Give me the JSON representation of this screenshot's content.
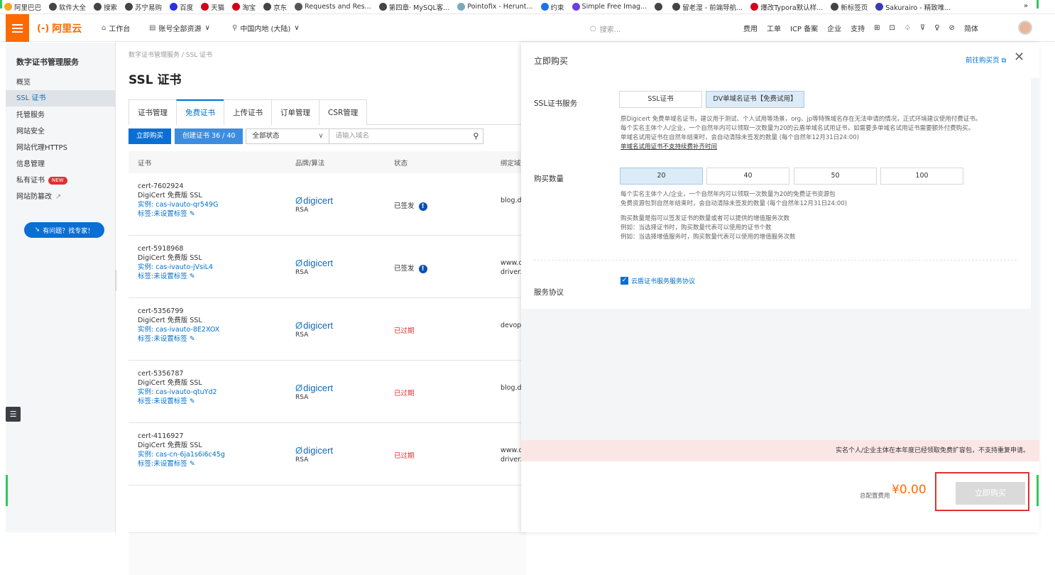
{
  "bookmarks": [
    {
      "label": "阿里巴巴",
      "color": "#f5a623"
    },
    {
      "label": "软件大全",
      "color": "#444"
    },
    {
      "label": "搜索",
      "color": "#444"
    },
    {
      "label": "苏宁易购",
      "color": "#444"
    },
    {
      "label": "百度",
      "color": "#2932e1"
    },
    {
      "label": "天猫",
      "color": "#d0021b"
    },
    {
      "label": "淘宝",
      "color": "#d0021b"
    },
    {
      "label": "京东",
      "color": "#444"
    },
    {
      "label": "Requests and Res...",
      "color": "#555"
    },
    {
      "label": "第四章· MySQL客...",
      "color": "#444"
    },
    {
      "label": "Pointofix - Herunt...",
      "color": "#7ab"
    },
    {
      "label": "约束",
      "color": "#1a73e8"
    },
    {
      "label": "Simple Free Imag...",
      "color": "#6a3de8"
    },
    {
      "label": "",
      "color": "#444"
    },
    {
      "label": "留老湿 - 前端导航...",
      "color": "#444"
    },
    {
      "label": "爆改Typora默认样...",
      "color": "#d0021b"
    },
    {
      "label": "新标签页",
      "color": "#444"
    },
    {
      "label": "Sakurairo - 精致唯...",
      "color": "#3a3ab0"
    }
  ],
  "bookmarks_more": "»",
  "topbar": {
    "logo": "阿里云",
    "workbench": "工作台",
    "account": "账号全部资源",
    "region": "中国内地 (大陆)",
    "search_placeholder": "搜索...",
    "links": [
      "费用",
      "工单",
      "ICP 备案",
      "企业",
      "支持"
    ],
    "lang": "简体"
  },
  "sidebar": {
    "title": "数字证书管理服务",
    "items": [
      "概览",
      "SSL 证书",
      "托管服务",
      "网站安全",
      "网站代理HTTPS",
      "信息管理",
      "私有证书",
      "网站防篡改"
    ],
    "new_badge": "NEW",
    "help": "有问题？找专家！",
    "external_icon": "↗"
  },
  "main": {
    "breadcrumb": "数字证书管理服务 / SSL 证书",
    "title": "SSL 证书",
    "tabs": [
      "证书管理",
      "免费证书",
      "上传证书",
      "订单管理",
      "CSR管理"
    ],
    "buy_button": "立即购买",
    "create_button": "创建证书 36 / 40",
    "status_select": "全部状态",
    "domain_placeholder": "请输入域名",
    "columns": [
      "证书",
      "品牌/算法",
      "状态",
      "绑定域"
    ],
    "rows": [
      {
        "id": "cert-7602924",
        "name": "DigiCert 免费版 SSL",
        "instance": "实例: cas-ivauto-qr549G",
        "tag": "标签:未设置标签",
        "brand": "digicert",
        "algo": "RSA",
        "status": "已签发",
        "expired": false,
        "domain1": "blog.dr",
        "domain2": ""
      },
      {
        "id": "cert-5918968",
        "name": "DigiCert 免费版 SSL",
        "instance": "实例: cas-ivauto-jVsiL4",
        "tag": "标签:未设置标签",
        "brand": "digicert",
        "algo": "RSA",
        "status": "已签发",
        "expired": false,
        "domain1": "www.d",
        "domain2": "driverz"
      },
      {
        "id": "cert-5356799",
        "name": "DigiCert 免费版 SSL",
        "instance": "实例: cas-ivauto-8E2XOX",
        "tag": "标签:未设置标签",
        "brand": "digicert",
        "algo": "RSA",
        "status": "已过期",
        "expired": true,
        "domain1": "devops",
        "domain2": ""
      },
      {
        "id": "cert-5356787",
        "name": "DigiCert 免费版 SSL",
        "instance": "实例: cas-ivauto-qtuYd2",
        "tag": "标签:未设置标签",
        "brand": "digicert",
        "algo": "RSA",
        "status": "已过期",
        "expired": true,
        "domain1": "blog.dr",
        "domain2": ""
      },
      {
        "id": "cert-4116927",
        "name": "DigiCert 免费版 SSL",
        "instance": "实例: cas-cn-6ja1s6i6c45g",
        "tag": "标签:未设置标签",
        "brand": "digicert",
        "algo": "RSA",
        "status": "已过期",
        "expired": true,
        "domain1": "www.d",
        "domain2": "driverz"
      }
    ]
  },
  "panel": {
    "title": "立即购买",
    "link": "前往购买页",
    "service_label": "SSL证书服务",
    "service_options": [
      "SSL证书",
      "DV单域名证书【免费试用】"
    ],
    "service_desc": [
      "原Digicert 免费单域名证书，建议用于测试、个人试用等场景，org、jp等特殊域名存在无法申请的情况，正式环境建议使用付费证书。",
      "每个实名主体个人/企业，一个自然年内可以领取一次数量为20的云盾单域名试用证书，如需要多单域名试用证书需要额外付费购买。",
      "单域名试用证书在自然年结束时，会自动清除未签发的数量 (每个自然年12月31日24:00)",
      "单域名试用证书不支持续费补齐时间"
    ],
    "qty_label": "购买数量",
    "qty_options": [
      "20",
      "40",
      "50",
      "100"
    ],
    "qty_desc": [
      "每个实名主体个人/企业，一个自然年内可以领取一次数量为20的免费证书资源包",
      "免费资源包到自然年结束时，会自动清除未签发的数量 (每个自然年12月31日24:00)",
      "购买数量是指可以签发证书的数量或者可以提供的增值服务次数",
      "例如：当选择证书时，购买数量代表可以使用的证书个数",
      "例如：当选择增值服务时，购买数量代表可以使用的增值服务次数"
    ],
    "agreement_label": "服务协议",
    "agreement_text": "云盾证书服务服务协议",
    "warning": "实名个人/企业主体在本年度已经领取免费扩容包，不支持重复申请。",
    "total_label": "总配置费用",
    "total_value": "¥0.00",
    "buy": "立即购买"
  },
  "colors": {
    "accent": "#ff6a00",
    "primary": "#0070cc",
    "error": "#e0312e"
  }
}
